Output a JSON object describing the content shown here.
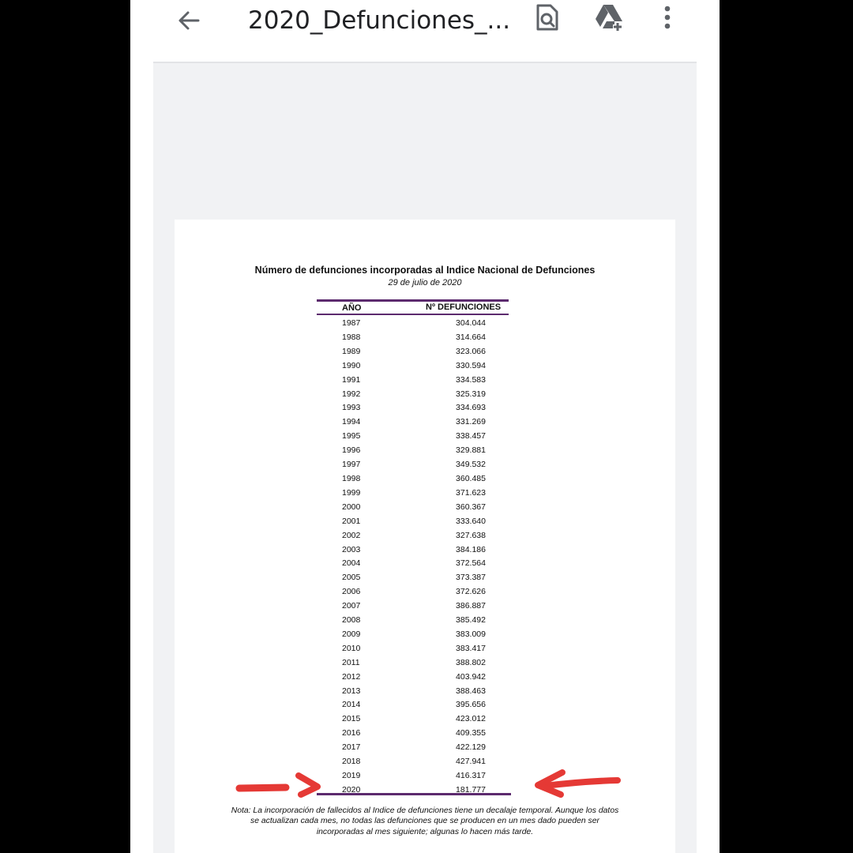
{
  "toolbar": {
    "title": "2020_Defunciones_...",
    "icons": {
      "back": "arrow-left-icon",
      "search_in_doc": "document-search-icon",
      "add_to_drive": "drive-add-icon",
      "more": "more-vert-icon"
    }
  },
  "document": {
    "title": "Número de defunciones incorporadas al Indice Nacional de Defunciones",
    "date": "29 de julio de 2020",
    "table": {
      "headers": [
        "AÑO",
        "Nº DEFUNCIONES"
      ],
      "rows": [
        [
          "1987",
          "304.044"
        ],
        [
          "1988",
          "314.664"
        ],
        [
          "1989",
          "323.066"
        ],
        [
          "1990",
          "330.594"
        ],
        [
          "1991",
          "334.583"
        ],
        [
          "1992",
          "325.319"
        ],
        [
          "1993",
          "334.693"
        ],
        [
          "1994",
          "331.269"
        ],
        [
          "1995",
          "338.457"
        ],
        [
          "1996",
          "329.881"
        ],
        [
          "1997",
          "349.532"
        ],
        [
          "1998",
          "360.485"
        ],
        [
          "1999",
          "371.623"
        ],
        [
          "2000",
          "360.367"
        ],
        [
          "2001",
          "333.640"
        ],
        [
          "2002",
          "327.638"
        ],
        [
          "2003",
          "384.186"
        ],
        [
          "2004",
          "372.564"
        ],
        [
          "2005",
          "373.387"
        ],
        [
          "2006",
          "372.626"
        ],
        [
          "2007",
          "386.887"
        ],
        [
          "2008",
          "385.492"
        ],
        [
          "2009",
          "383.009"
        ],
        [
          "2010",
          "383.417"
        ],
        [
          "2011",
          "388.802"
        ],
        [
          "2012",
          "403.942"
        ],
        [
          "2013",
          "388.463"
        ],
        [
          "2014",
          "395.656"
        ],
        [
          "2015",
          "423.012"
        ],
        [
          "2016",
          "409.355"
        ],
        [
          "2017",
          "422.129"
        ],
        [
          "2018",
          "427.941"
        ],
        [
          "2019",
          "416.317"
        ],
        [
          "2020",
          "181.777"
        ]
      ]
    },
    "note": "Nota: La incorporación de fallecidos al Indice de defunciones tiene un decalaje temporal. Aunque los datos se actualizan cada mes, no todas las defunciones  que se producen en un mes dado pueden ser incorporadas al mes siguiente; algunas lo hacen más tarde."
  },
  "colors": {
    "rule": "#5c2a6e",
    "annotation_arrow": "#e53935",
    "viewer_bg": "#f1f2f4"
  }
}
